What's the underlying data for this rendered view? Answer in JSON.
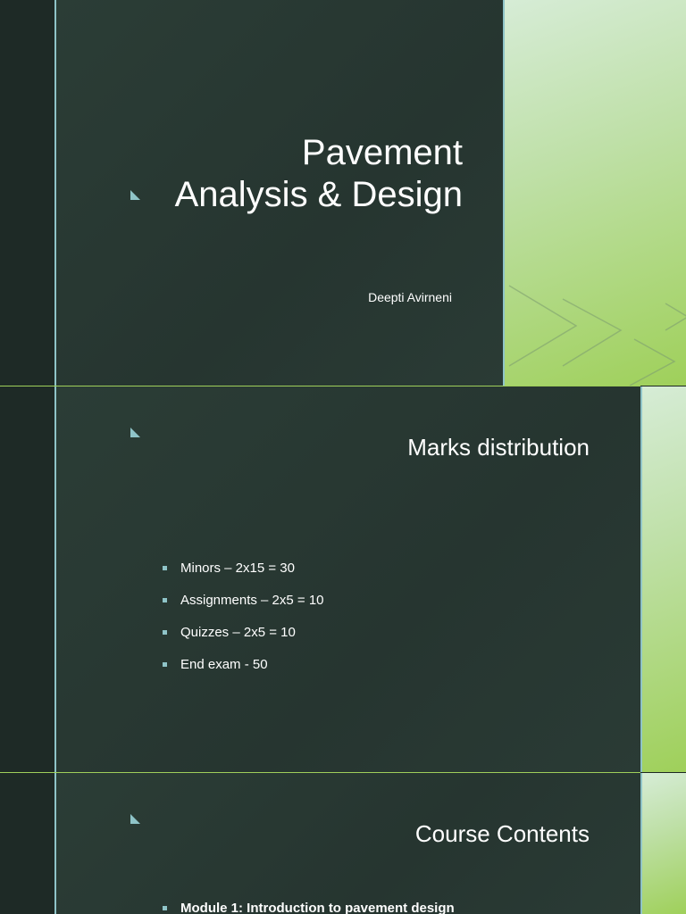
{
  "slides": [
    {
      "title_line1": "Pavement",
      "title_line2": "Analysis & Design",
      "subtitle": "Deepti Avirneni"
    },
    {
      "title": "Marks distribution",
      "bullets": [
        "Minors – 2x15 = 30",
        "Assignments – 2x5 = 10",
        "Quizzes – 2x5 = 10",
        "End exam - 50"
      ]
    },
    {
      "title": "Course Contents",
      "bullets": [
        "Module 1: Introduction to pavement design"
      ]
    }
  ],
  "colors": {
    "accent": "#8fc4c8",
    "slide_bg": "#2b3d36",
    "green": "#9fd05a"
  }
}
